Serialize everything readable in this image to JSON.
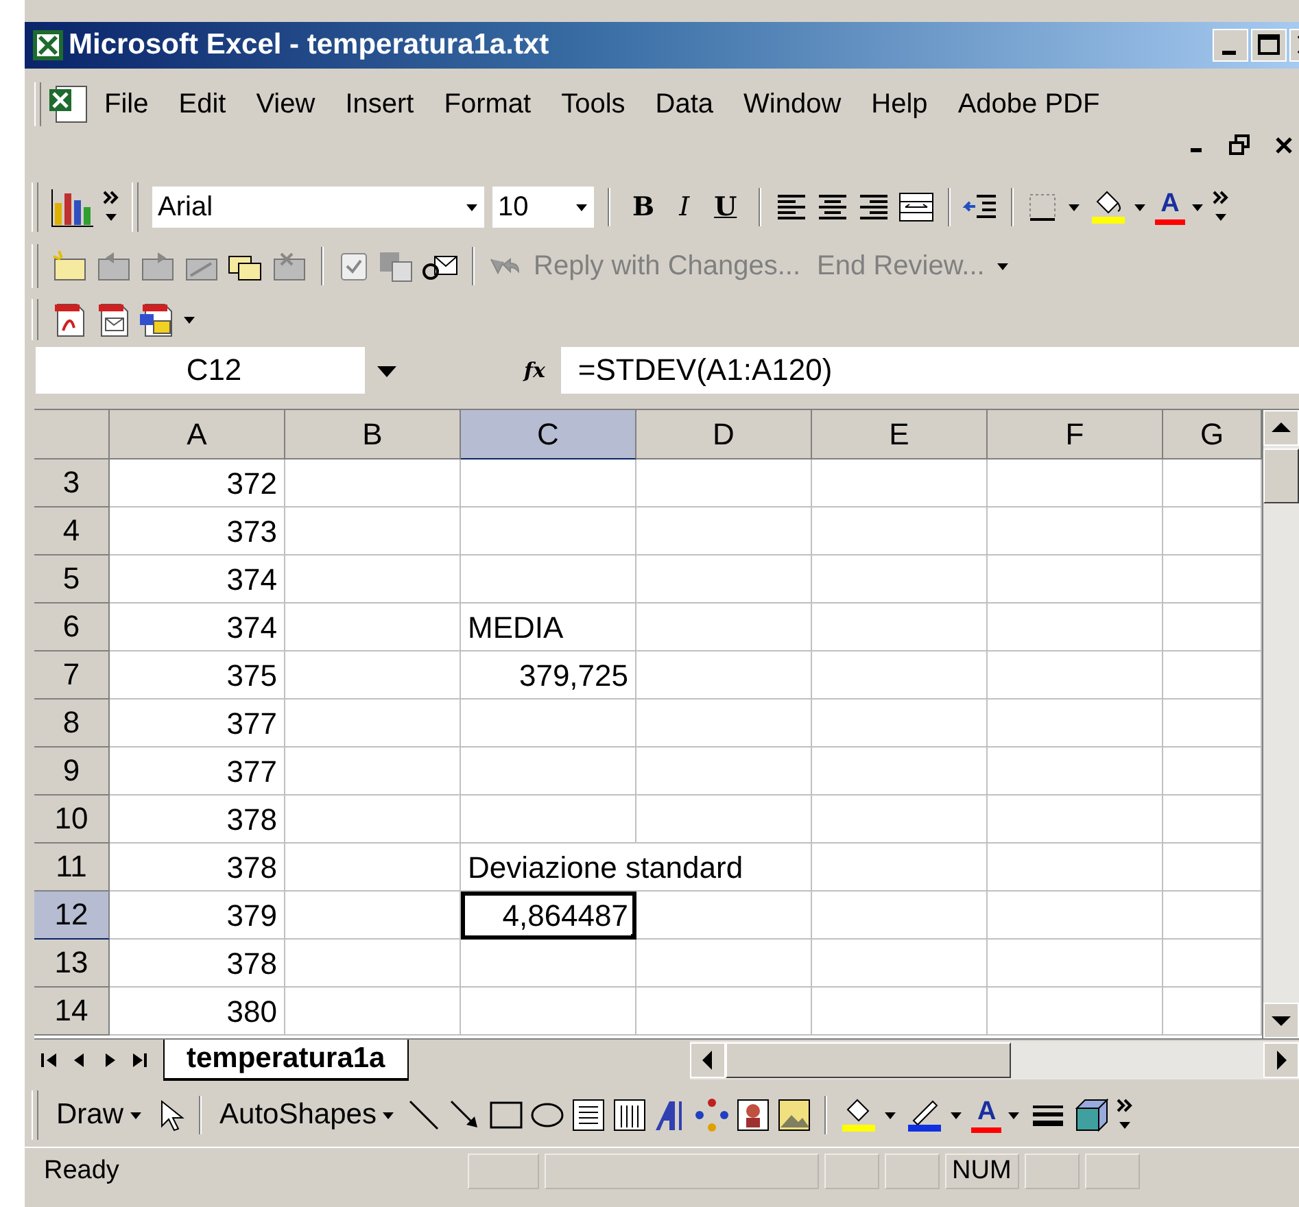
{
  "window": {
    "title": "Microsoft Excel - temperatura1a.txt"
  },
  "menu": [
    "File",
    "Edit",
    "View",
    "Insert",
    "Format",
    "Tools",
    "Data",
    "Window",
    "Help",
    "Adobe PDF"
  ],
  "formatting_toolbar": {
    "font": "Arial",
    "size": "10",
    "style_buttons": [
      "B",
      "I",
      "U"
    ],
    "font_color_button": "A"
  },
  "reviewing_toolbar": {
    "buttons": [
      "Reply with Changes...",
      "End Review..."
    ]
  },
  "formula_bar": {
    "name_box": "C12",
    "fx": "fx",
    "formula": "=STDEV(A1:A120)"
  },
  "sheet": {
    "columns": [
      {
        "label": "A",
        "selected": false
      },
      {
        "label": "B",
        "selected": false
      },
      {
        "label": "C",
        "selected": true
      },
      {
        "label": "D",
        "selected": false
      },
      {
        "label": "E",
        "selected": false
      },
      {
        "label": "F",
        "selected": false
      },
      {
        "label": "G",
        "selected": false
      }
    ],
    "rows": [
      {
        "header": "3",
        "selected": false,
        "cells": [
          {
            "kind": "number",
            "text": "372",
            "selected": false
          },
          {
            "kind": "empty",
            "selected": false
          },
          {
            "kind": "empty",
            "selected": false
          },
          {
            "kind": "empty",
            "selected": false
          },
          {
            "kind": "empty",
            "selected": false
          },
          {
            "kind": "empty",
            "selected": false
          },
          {
            "kind": "empty",
            "selected": false
          }
        ]
      },
      {
        "header": "4",
        "selected": false,
        "cells": [
          {
            "kind": "number",
            "text": "373",
            "selected": false
          },
          {
            "kind": "empty",
            "selected": false
          },
          {
            "kind": "empty",
            "selected": false
          },
          {
            "kind": "empty",
            "selected": false
          },
          {
            "kind": "empty",
            "selected": false
          },
          {
            "kind": "empty",
            "selected": false
          },
          {
            "kind": "empty",
            "selected": false
          }
        ]
      },
      {
        "header": "5",
        "selected": false,
        "cells": [
          {
            "kind": "number",
            "text": "374",
            "selected": false
          },
          {
            "kind": "empty",
            "selected": false
          },
          {
            "kind": "empty",
            "selected": false
          },
          {
            "kind": "empty",
            "selected": false
          },
          {
            "kind": "empty",
            "selected": false
          },
          {
            "kind": "empty",
            "selected": false
          },
          {
            "kind": "empty",
            "selected": false
          }
        ]
      },
      {
        "header": "6",
        "selected": false,
        "cells": [
          {
            "kind": "number",
            "text": "374",
            "selected": false
          },
          {
            "kind": "empty",
            "selected": false
          },
          {
            "kind": "text",
            "text": "MEDIA",
            "selected": false
          },
          {
            "kind": "empty",
            "selected": false
          },
          {
            "kind": "empty",
            "selected": false
          },
          {
            "kind": "empty",
            "selected": false
          },
          {
            "kind": "empty",
            "selected": false
          }
        ]
      },
      {
        "header": "7",
        "selected": false,
        "cells": [
          {
            "kind": "number",
            "text": "375",
            "selected": false
          },
          {
            "kind": "empty",
            "selected": false
          },
          {
            "kind": "number",
            "text": "379,725",
            "selected": false
          },
          {
            "kind": "empty",
            "selected": false
          },
          {
            "kind": "empty",
            "selected": false
          },
          {
            "kind": "empty",
            "selected": false
          },
          {
            "kind": "empty",
            "selected": false
          }
        ]
      },
      {
        "header": "8",
        "selected": false,
        "cells": [
          {
            "kind": "number",
            "text": "377",
            "selected": false
          },
          {
            "kind": "empty",
            "selected": false
          },
          {
            "kind": "empty",
            "selected": false
          },
          {
            "kind": "empty",
            "selected": false
          },
          {
            "kind": "empty",
            "selected": false
          },
          {
            "kind": "empty",
            "selected": false
          },
          {
            "kind": "empty",
            "selected": false
          }
        ]
      },
      {
        "header": "9",
        "selected": false,
        "cells": [
          {
            "kind": "number",
            "text": "377",
            "selected": false
          },
          {
            "kind": "empty",
            "selected": false
          },
          {
            "kind": "empty",
            "selected": false
          },
          {
            "kind": "empty",
            "selected": false
          },
          {
            "kind": "empty",
            "selected": false
          },
          {
            "kind": "empty",
            "selected": false
          },
          {
            "kind": "empty",
            "selected": false
          }
        ]
      },
      {
        "header": "10",
        "selected": false,
        "cells": [
          {
            "kind": "number",
            "text": "378",
            "selected": false
          },
          {
            "kind": "empty",
            "selected": false
          },
          {
            "kind": "empty",
            "selected": false
          },
          {
            "kind": "empty",
            "selected": false
          },
          {
            "kind": "empty",
            "selected": false
          },
          {
            "kind": "empty",
            "selected": false
          },
          {
            "kind": "empty",
            "selected": false
          }
        ]
      },
      {
        "header": "11",
        "selected": false,
        "cells": [
          {
            "kind": "number",
            "text": "378",
            "selected": false
          },
          {
            "kind": "empty",
            "selected": false
          },
          {
            "kind": "overflow_text",
            "text": "Deviazione standard",
            "selected": false
          },
          {
            "kind": "empty",
            "selected": false
          },
          {
            "kind": "empty",
            "selected": false
          },
          {
            "kind": "empty",
            "selected": false
          }
        ]
      },
      {
        "header": "12",
        "selected": true,
        "cells": [
          {
            "kind": "number",
            "text": "379",
            "selected": false
          },
          {
            "kind": "empty",
            "selected": false
          },
          {
            "kind": "number",
            "text": "4,864487",
            "selected": true
          },
          {
            "kind": "empty",
            "selected": false
          },
          {
            "kind": "empty",
            "selected": false
          },
          {
            "kind": "empty",
            "selected": false
          },
          {
            "kind": "empty",
            "selected": false
          }
        ]
      },
      {
        "header": "13",
        "selected": false,
        "cells": [
          {
            "kind": "number",
            "text": "378",
            "selected": false
          },
          {
            "kind": "empty",
            "selected": false
          },
          {
            "kind": "empty",
            "selected": false
          },
          {
            "kind": "empty",
            "selected": false
          },
          {
            "kind": "empty",
            "selected": false
          },
          {
            "kind": "empty",
            "selected": false
          },
          {
            "kind": "empty",
            "selected": false
          }
        ]
      },
      {
        "header": "14",
        "selected": false,
        "cells": [
          {
            "kind": "number",
            "text": "380",
            "selected": false
          },
          {
            "kind": "empty",
            "selected": false
          },
          {
            "kind": "empty",
            "selected": false
          },
          {
            "kind": "empty",
            "selected": false
          },
          {
            "kind": "empty",
            "selected": false
          },
          {
            "kind": "empty",
            "selected": false
          },
          {
            "kind": "empty",
            "selected": false
          }
        ]
      }
    ]
  },
  "sheet_tabs": [
    {
      "label": "temperatura1a",
      "selected": true
    }
  ],
  "drawing_toolbar": {
    "buttons": [
      "Draw",
      "AutoShapes"
    ],
    "font_color_button": "A"
  },
  "status_bar": {
    "status": "Ready",
    "indicators": [
      "NUM"
    ]
  }
}
